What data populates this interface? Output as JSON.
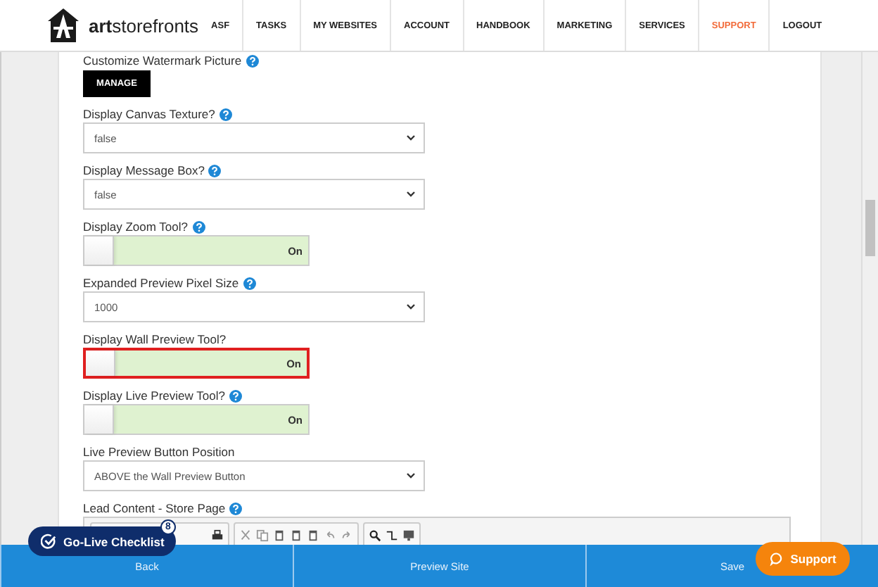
{
  "header": {
    "logo": "**art**storefronts",
    "nav": [
      {
        "label": "ASF",
        "selected": false
      },
      {
        "label": "TASKS",
        "selected": false
      },
      {
        "label": "MY WEBSITES",
        "selected": false
      },
      {
        "label": "ACCOUNT",
        "selected": false
      },
      {
        "label": "HANDBOOK",
        "selected": false
      },
      {
        "label": "MARKETING",
        "selected": false
      },
      {
        "label": "SERVICES",
        "selected": false
      },
      {
        "label": "SUPPORT",
        "selected": true
      },
      {
        "label": "LOGOUT",
        "selected": false
      }
    ]
  },
  "fields": [
    {
      "kind": "button",
      "label": "Customize Watermark Picture",
      "help": true,
      "button": "MANAGE"
    },
    {
      "kind": "select",
      "label": "Display Canvas Texture?",
      "help": true,
      "value": "false"
    },
    {
      "kind": "select",
      "label": "Display Message Box?",
      "help": true,
      "value": "false"
    },
    {
      "kind": "toggle",
      "label": "Display Zoom Tool?",
      "help": true,
      "on": true,
      "text": "On",
      "highlighted": false
    },
    {
      "kind": "select",
      "label": "Expanded Preview Pixel Size",
      "help": true,
      "value": "1000"
    },
    {
      "kind": "toggle",
      "label": "Display Wall Preview Tool?",
      "help": false,
      "on": true,
      "text": "On",
      "highlighted": true
    },
    {
      "kind": "toggle",
      "label": "Display Live Preview Tool?",
      "help": true,
      "on": true,
      "text": "On",
      "highlighted": false
    },
    {
      "kind": "select",
      "label": "Live Preview Button Position",
      "help": false,
      "value": "ABOVE the Wall Preview Button"
    },
    {
      "kind": "editor",
      "label": "Lead Content - Store Page",
      "help": true
    }
  ],
  "footer": {
    "buttons": [
      "Back",
      "Preview Site",
      "Save"
    ]
  },
  "checklist": {
    "label": "Go-Live Checklist",
    "count": "8"
  },
  "support": {
    "label": "Support"
  }
}
